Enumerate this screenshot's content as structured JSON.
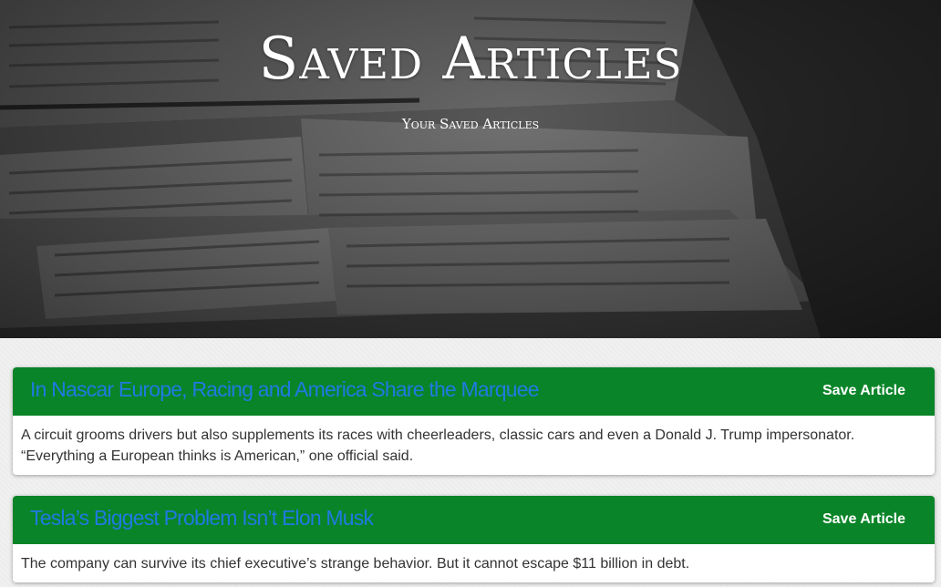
{
  "hero": {
    "title": "Saved Articles",
    "subtitle": "Your Saved Articles"
  },
  "articles": [
    {
      "title": "In Nascar Europe, Racing and America Share the Marquee",
      "button_label": "Save Article",
      "summary": "A circuit grooms drivers but also supplements its races with cheerleaders, classic cars and even a Donald J. Trump impersonator. “Everything a European thinks is American,” one official said."
    },
    {
      "title": "Tesla’s Biggest Problem Isn’t Elon Musk",
      "button_label": "Save Article",
      "summary": "The company can survive its chief executive’s strange behavior. But it cannot escape $11 billion in debt."
    }
  ],
  "colors": {
    "card_header": "#0a8428",
    "title_link": "#1e7be0"
  }
}
